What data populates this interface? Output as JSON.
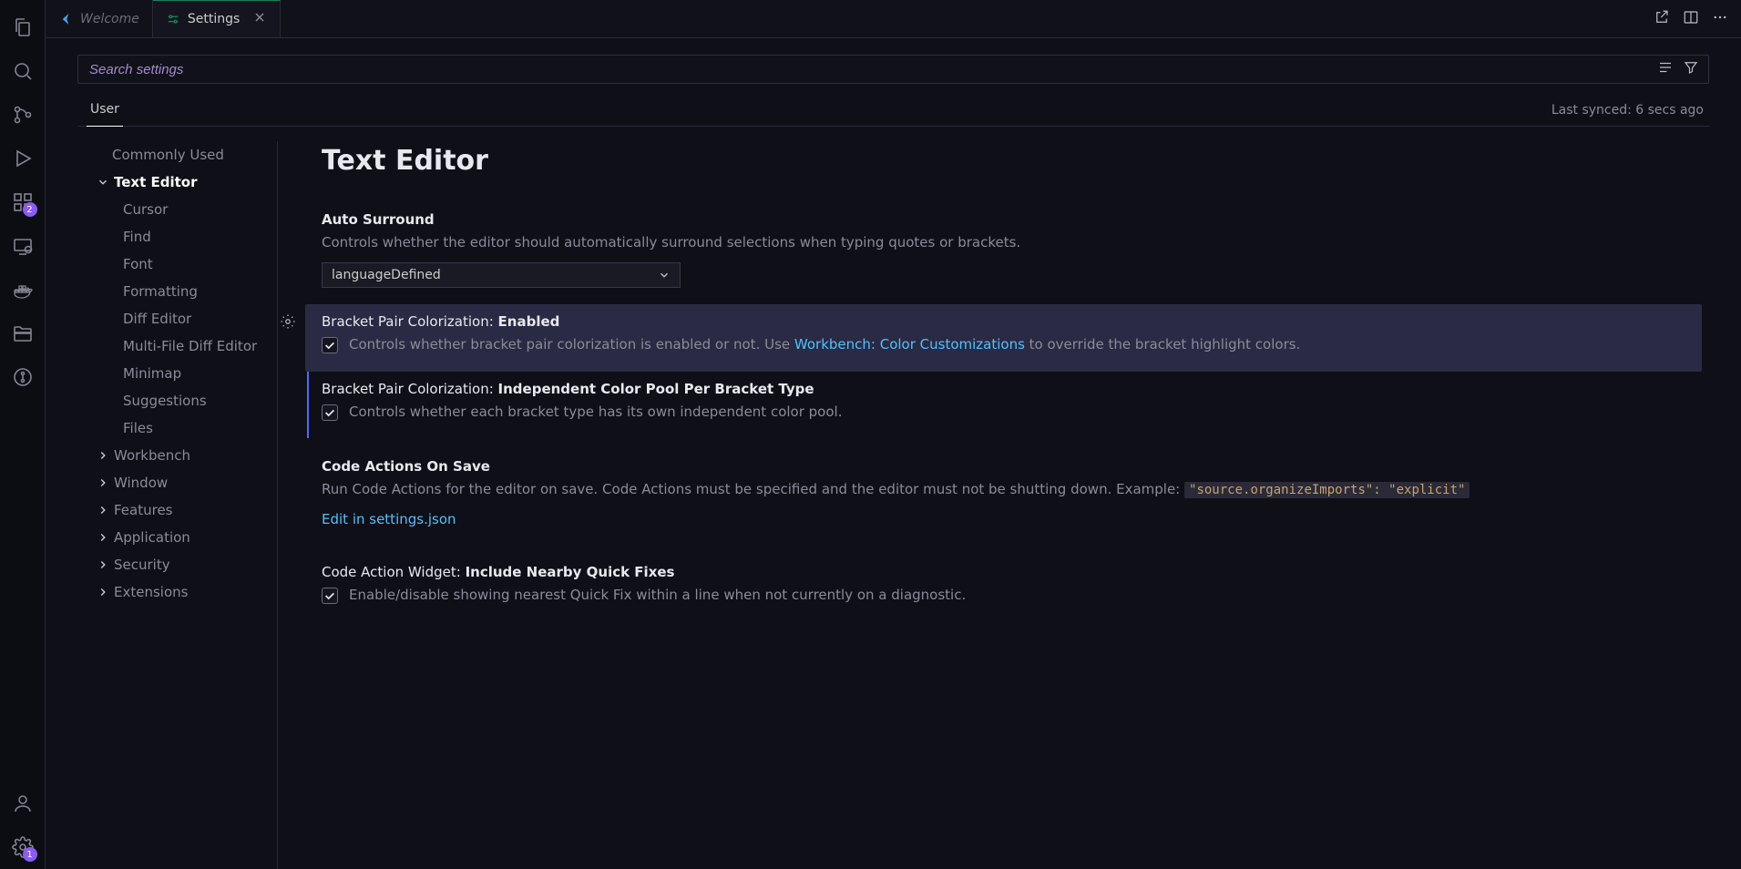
{
  "tabs": {
    "welcome": "Welcome",
    "settings": "Settings"
  },
  "search": {
    "placeholder": "Search settings"
  },
  "scope": {
    "user": "User"
  },
  "sync_status": "Last synced: 6 secs ago",
  "badges": {
    "extensions": "2",
    "settings_gear": "1"
  },
  "toc": {
    "commonly_used": "Commonly Used",
    "text_editor": "Text Editor",
    "cursor": "Cursor",
    "find": "Find",
    "font": "Font",
    "formatting": "Formatting",
    "diff_editor": "Diff Editor",
    "multifile_diff": "Multi-File Diff Editor",
    "minimap": "Minimap",
    "suggestions": "Suggestions",
    "files": "Files",
    "workbench": "Workbench",
    "window": "Window",
    "features": "Features",
    "application": "Application",
    "security": "Security",
    "extensions": "Extensions"
  },
  "content": {
    "section_title": "Text Editor",
    "auto_surround": {
      "title_prefix": "",
      "title_name": "Auto Surround",
      "desc": "Controls whether the editor should automatically surround selections when typing quotes or brackets.",
      "value": "languageDefined"
    },
    "bpc_enabled": {
      "title_prefix": "Bracket Pair Colorization: ",
      "title_name": "Enabled",
      "desc_pre": "Controls whether bracket pair colorization is enabled or not. Use ",
      "desc_link": "Workbench: Color Customizations",
      "desc_post": " to override the bracket highlight colors."
    },
    "bpc_independent": {
      "title_prefix": "Bracket Pair Colorization: ",
      "title_name": "Independent Color Pool Per Bracket Type",
      "desc": "Controls whether each bracket type has its own independent color pool."
    },
    "code_actions_save": {
      "title_prefix": "",
      "title_name": "Code Actions On Save",
      "desc_pre": "Run Code Actions for the editor on save. Code Actions must be specified and the editor must not be shutting down. Example: ",
      "code1": "\"source.organizeImports\": \"explicit\"",
      "edit_link": "Edit in settings.json"
    },
    "code_action_widget": {
      "title_prefix": "Code Action Widget: ",
      "title_name": "Include Nearby Quick Fixes",
      "desc": "Enable/disable showing nearest Quick Fix within a line when not currently on a diagnostic."
    }
  }
}
